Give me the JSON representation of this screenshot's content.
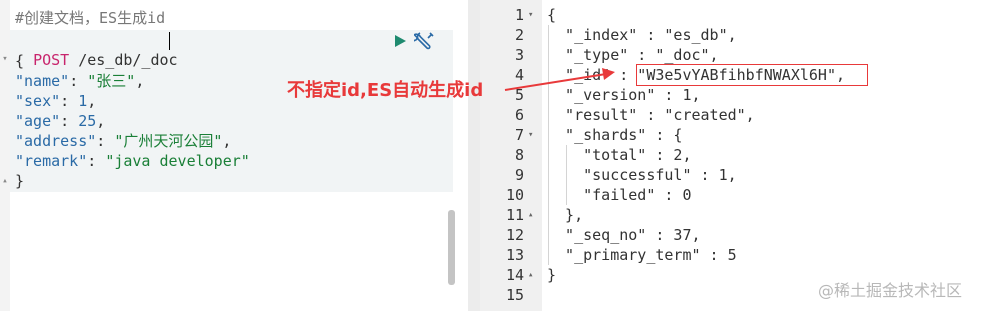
{
  "request": {
    "comment": "#创建文档，ES生成id",
    "method": "POST",
    "path": " /es_db/_doc",
    "body": [
      {
        "text": "{"
      },
      {
        "key": "\"name\"",
        "sep": ": ",
        "value": "\"张三\"",
        "end": ","
      },
      {
        "key": "\"sex\"",
        "sep": ": ",
        "value": "1",
        "end": ","
      },
      {
        "key": "\"age\"",
        "sep": ": ",
        "value": "25",
        "end": ","
      },
      {
        "key": "\"address\"",
        "sep": ": ",
        "value": "\"广州天河公园\"",
        "end": ","
      },
      {
        "key": "\"remark\"",
        "sep": ": ",
        "value": "\"java developer\"",
        "end": ""
      },
      {
        "text": "}"
      }
    ]
  },
  "response": {
    "line_numbers": [
      "1",
      "2",
      "3",
      "4",
      "5",
      "6",
      "7",
      "8",
      "9",
      "10",
      "11",
      "12",
      "13",
      "14",
      "15"
    ],
    "lines": [
      "{",
      "  \"_index\" : \"es_db\",",
      "  \"_type\" : \"_doc\",",
      "  \"_id\" : \"W3e5vYABfihbfNWAXl6H\",",
      "  \"_version\" : 1,",
      "  \"result\" : \"created\",",
      "  \"_shards\" : {",
      "    \"total\" : 2,",
      "    \"successful\" : 1,",
      "    \"failed\" : 0",
      "  },",
      "  \"_seq_no\" : 37,",
      "  \"_primary_term\" : 5",
      "}",
      ""
    ]
  },
  "annotation": "不指定id,ES自动生成id",
  "watermark": "@稀土掘金技术社区",
  "colors": {
    "annotation": "#e8393a",
    "method": "#c8246c",
    "key": "#2a6aa6",
    "string": "#1a7f37",
    "run_button": "#1e8a6f",
    "wrench": "#2a6aa6"
  }
}
